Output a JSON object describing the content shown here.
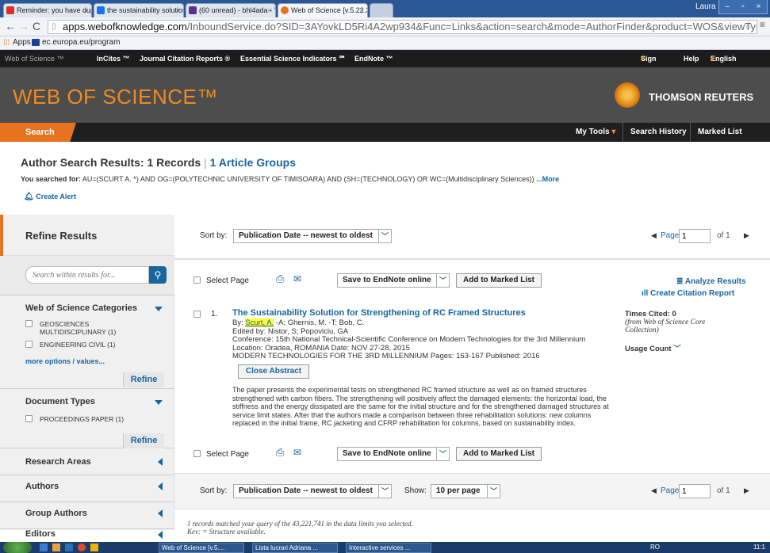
{
  "browser": {
    "tabs": [
      {
        "label": "Reminder: you have dupli",
        "color": "#d93025"
      },
      {
        "label": "the sustainability solution",
        "color": "#1a73e8"
      },
      {
        "label": "(60 unread) - bhl4ada - Y",
        "color": "#5f2d91"
      },
      {
        "label": "Web of Science [v.5.22.3]",
        "color": "#e8731f"
      }
    ],
    "user": "Laura",
    "url_host": "apps.webofknowledge.com",
    "url_path": "/InboundService.do?SID=3AYovkLD5Ri4A2wp934&Func=Links&action=search&mode=AuthorFinder&product=WOS&viewType=",
    "bookmarks": [
      "Apps",
      "ec.europa.eu/program"
    ]
  },
  "wos_topnav": {
    "items": [
      "Web of Science ™",
      "InCites ™",
      "Journal Citation Reports ®",
      "Essential Science Indicators ℠",
      "EndNote ™"
    ],
    "sign_in": "Sign In",
    "help": "Help",
    "language": "English"
  },
  "banner": {
    "logo": "WEB OF SCIENCE™",
    "brand": "THOMSON REUTERS"
  },
  "navbar": {
    "search": "Search",
    "my_tools": "My Tools",
    "search_history": "Search History",
    "marked_list": "Marked List"
  },
  "results_header": {
    "title": "Author Search Results: 1 Records",
    "article_groups": "1 Article Groups",
    "you_searched_label": "You searched for:",
    "query": "AU=(SCURT A. *) AND OG=(POLYTECHNIC UNIVERSITY OF TIMISOARA) AND (SH=(TECHNOLOGY) OR WC=(Multidisciplinary Sciences))",
    "more": "...More",
    "create_alert": "Create Alert"
  },
  "sidebar": {
    "refine_results": "Refine Results",
    "search_placeholder": "Search within results for...",
    "wos_categories": "Web of Science Categories",
    "categories": [
      "GEOSCIENCES MULTIDISCIPLINARY (1)",
      "ENGINEERING CIVIL (1)"
    ],
    "more_options": "more options / values...",
    "refine": "Refine",
    "document_types": "Document Types",
    "doc_types": [
      "PROCEEDINGS PAPER (1)"
    ],
    "sections": [
      "Research Areas",
      "Authors",
      "Group Authors",
      "Editors"
    ]
  },
  "main": {
    "sort_by": "Sort by:",
    "sort_value": "Publication Date -- newest to oldest",
    "page_label": "Page",
    "page_value": "1",
    "of_pages": "of 1",
    "select_page": "Select Page",
    "save_endnote": "Save to EndNote online",
    "add_marked": "Add to Marked List",
    "analyze_results": "Analyze Results",
    "create_citation_report": "Create Citation Report",
    "show_label": "Show:",
    "show_value": "10 per page",
    "footer_text": "1 records matched your query of the 43,221,741 in the data limits you selected.",
    "key_text": "Key: = Structure available.",
    "record": {
      "number": "1.",
      "title": "The Sustainability Solution for Strengthening of RC Framed Structures",
      "by_label": "By:",
      "highlight_author": "Scurt, A.",
      "authors_rest": "-A; Ghernis, M. -T; Bob, C.",
      "edited_by": "Edited by: Nistor, S; Popoviciu, GA",
      "conference": "Conference: 15th National Technical-Scientific Conference on Modern Technologies for the 3rd Millennium",
      "location": "Location: Oradea, ROMANIA Date: NOV 27-28, 2015",
      "source": "MODERN TECHNOLOGIES FOR THE 3RD MILLENNIUM   Pages: 163-167   Published: 2016",
      "close_abstract": "Close Abstract",
      "abstract": "The paper presents the experimental tests on strengthened RC framed structure as well as on framed structures strengthened with carbon fibers. The strengthening will positively affect the damaged elements: the horizontal load, the stiffness and the energy dissipated are the same for the initial structure and for the strengthened damaged structures at service limit states. After that the authors made a comparison between three rehabilitation solutions: new columns replaced in the initial frame, RC jacketing and CFRP rehabilitation for columns, based on sustainability index.",
      "times_cited": "Times Cited: 0",
      "from_wos": "(from Web of Science Core Collection)",
      "usage_count": "Usage Count"
    }
  },
  "taskbar": {
    "items": [
      "Web of Science [v.5....",
      "Lista lucrari Adriana ...",
      "Interactive services ..."
    ],
    "lang": "RO",
    "time": "11:1"
  }
}
